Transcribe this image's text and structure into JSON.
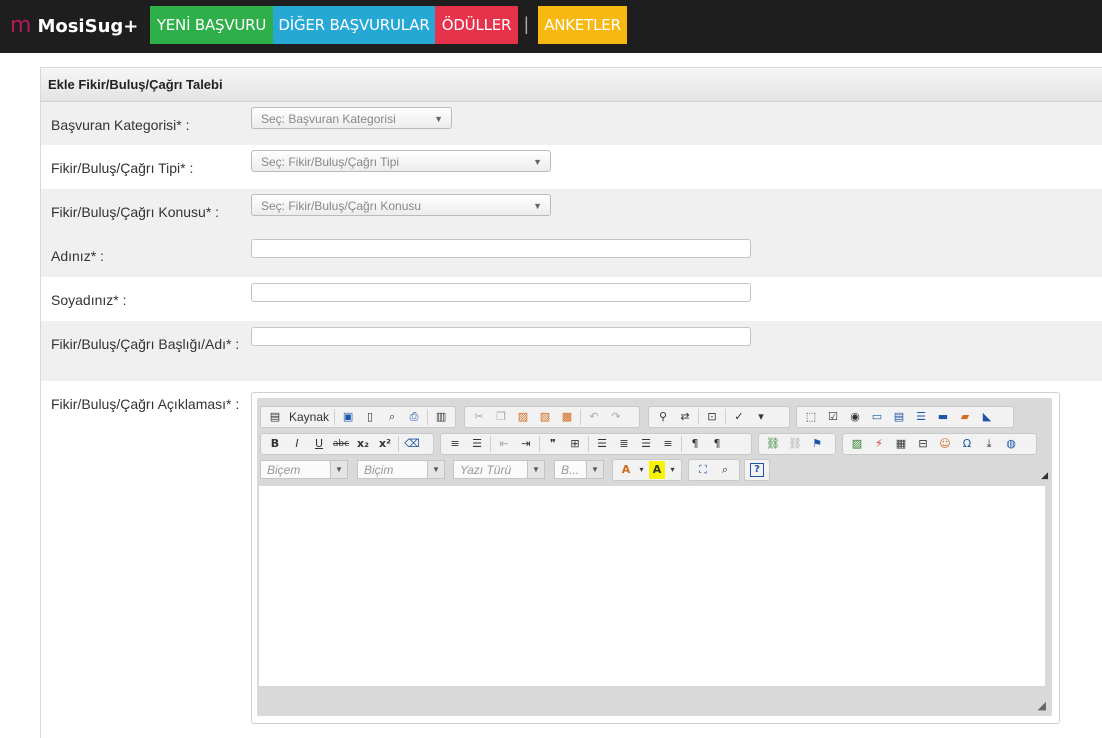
{
  "nav": {
    "brand_logo": "m",
    "brand": "MosiSug+",
    "items": [
      {
        "label": "YENİ BAŞVURU",
        "color": "#2eaf4a"
      },
      {
        "label": "DİĞER BAŞVURULAR",
        "color": "#26a8d4"
      },
      {
        "label": "ÖDÜLLER",
        "color": "#e6324b"
      },
      {
        "label": "ANKETLER",
        "color": "#f7b811"
      }
    ],
    "separator": "|"
  },
  "form": {
    "title": "Ekle Fikir/Buluş/Çağrı Talebi",
    "fields": {
      "category": {
        "label": "Başvuran Kategorisi* :",
        "placeholder": "Seç: Başvuran Kategorisi"
      },
      "type": {
        "label": "Fikir/Buluş/Çağrı Tipi* :",
        "placeholder": "Seç: Fikir/Buluş/Çağrı Tipi"
      },
      "topic": {
        "label": "Fikir/Buluş/Çağrı Konusu* :",
        "placeholder": "Seç: Fikir/Buluş/Çağrı Konusu"
      },
      "name": {
        "label": "Adınız* :",
        "value": ""
      },
      "surname": {
        "label": "Soyadınız* :",
        "value": ""
      },
      "title": {
        "label": "Fikir/Buluş/Çağrı Başlığı/Adı* :",
        "value": ""
      },
      "description": {
        "label": "Fikir/Buluş/Çağrı Açıklaması* :"
      }
    }
  },
  "editor": {
    "source_label": "Kaynak",
    "combos": [
      "Biçem",
      "Biçim",
      "Yazı Türü",
      "B..."
    ],
    "body": ""
  }
}
